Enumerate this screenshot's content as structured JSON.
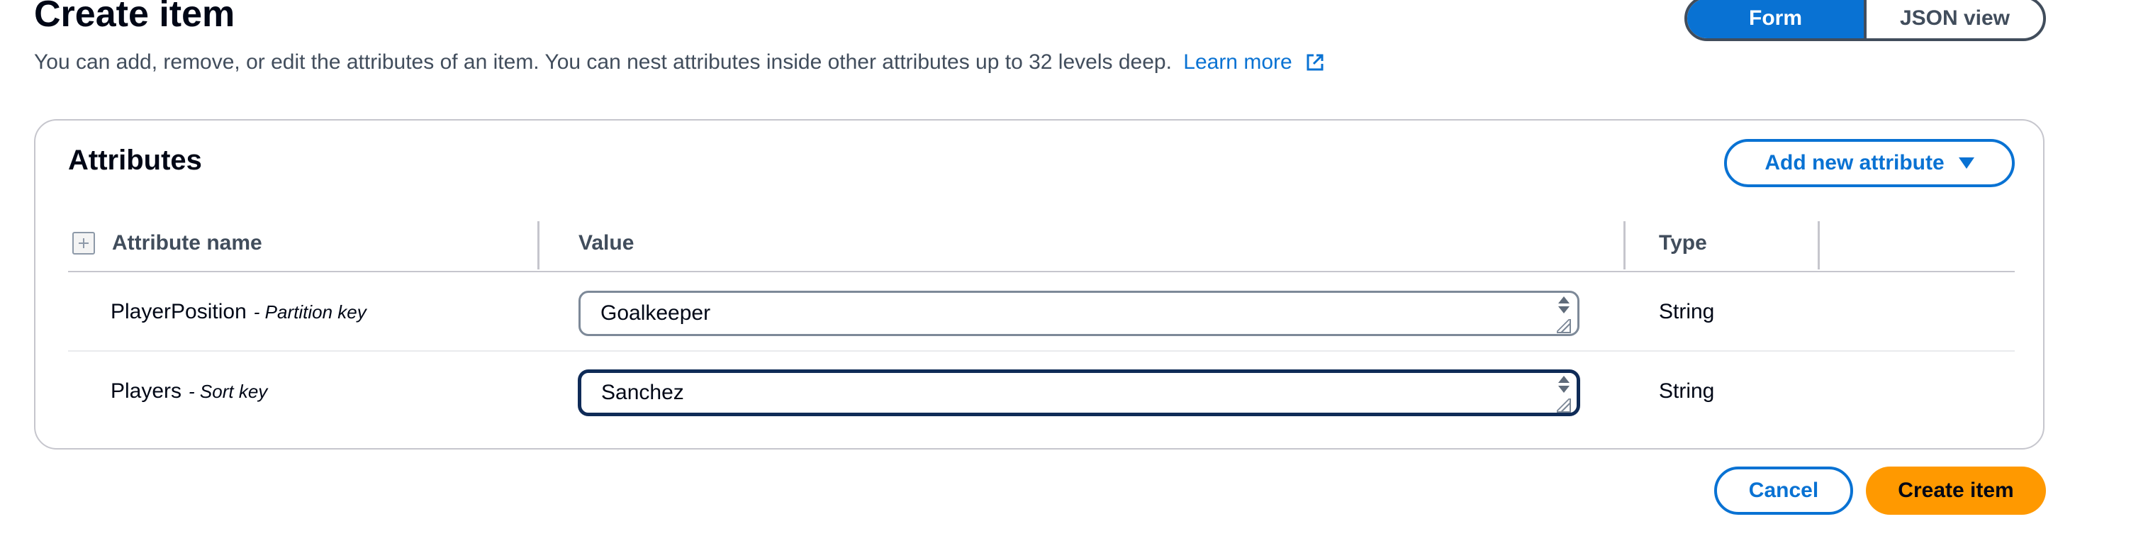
{
  "header": {
    "title": "Create item",
    "description": "You can add, remove, or edit the attributes of an item. You can nest attributes inside other attributes up to 32 levels deep.",
    "learn_more_label": "Learn more",
    "learn_more_icon": "external-link-icon"
  },
  "view_toggle": {
    "options": [
      "Form",
      "JSON view"
    ],
    "selected": "Form"
  },
  "attributes_panel": {
    "title": "Attributes",
    "add_button_label": "Add new attribute",
    "add_button_icon": "caret-down-icon",
    "columns": {
      "attribute_name": "Attribute name",
      "value": "Value",
      "type": "Type"
    },
    "rows": [
      {
        "attribute_name": "PlayerPosition",
        "key_label": "- Partition key",
        "value": "Goalkeeper",
        "type": "String"
      },
      {
        "attribute_name": "Players",
        "key_label": "- Sort key",
        "value": "Sanchez",
        "type": "String"
      }
    ]
  },
  "footer": {
    "cancel_label": "Cancel",
    "create_label": "Create item"
  },
  "colors": {
    "primary_blue": "#0972d3",
    "orange_action": "#ff9900",
    "text_dark": "#000716",
    "text_muted": "#414d5c",
    "border_gray": "#c6c6cd",
    "focus_navy": "#0f2b57"
  }
}
